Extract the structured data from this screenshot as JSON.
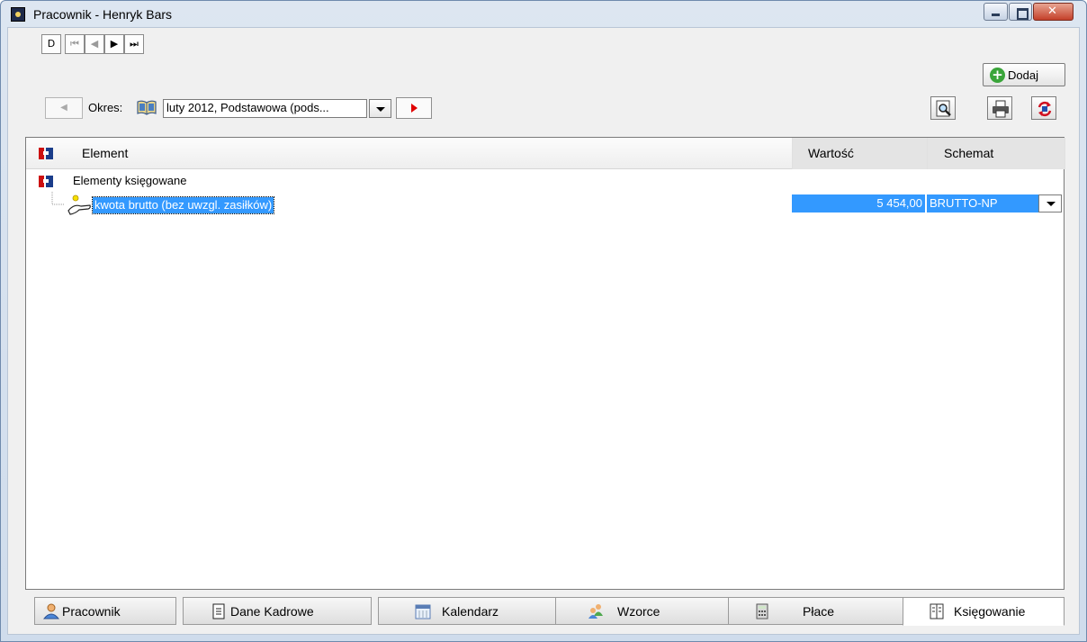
{
  "window": {
    "title": "Pracownik - Henryk Bars",
    "icons": [
      "app-icon",
      "minimize-icon",
      "maximize-icon",
      "close-icon"
    ]
  },
  "toolbar": {
    "nav": [
      {
        "label": "D",
        "name": "data-button"
      },
      {
        "label": "⏮",
        "name": "first-record-button"
      },
      {
        "label": "◀",
        "name": "prev-record-button"
      },
      {
        "label": "▶",
        "name": "next-record-button"
      },
      {
        "label": "⏭",
        "name": "last-record-button"
      }
    ],
    "add_label": "Dodaj",
    "period_label": "Okres:",
    "period_value": "luty 2012, Podstawowa (pods...",
    "accent_red": "#e00000"
  },
  "grid": {
    "columns": [
      "Element",
      "Wartość",
      "Schemat"
    ],
    "group_label": "Elementy księgowane",
    "rows": [
      {
        "element": "kwota brutto (bez uwzgl. zasiłków)",
        "value": "5 454,00",
        "scheme": "BRUTTO-NP"
      }
    ],
    "selection_color": "#3399ff"
  },
  "tabs": [
    {
      "label": "Pracownik",
      "icon": "person-icon",
      "active": false
    },
    {
      "label": "Dane Kadrowe",
      "icon": "document-icon",
      "active": false
    },
    {
      "label": "Kalendarz",
      "icon": "calendar-icon",
      "active": false
    },
    {
      "label": "Wzorce",
      "icon": "people-icon",
      "active": false
    },
    {
      "label": "Płace",
      "icon": "calculator-icon",
      "active": false
    },
    {
      "label": "Księgowanie",
      "icon": "ledger-icon",
      "active": true
    }
  ]
}
